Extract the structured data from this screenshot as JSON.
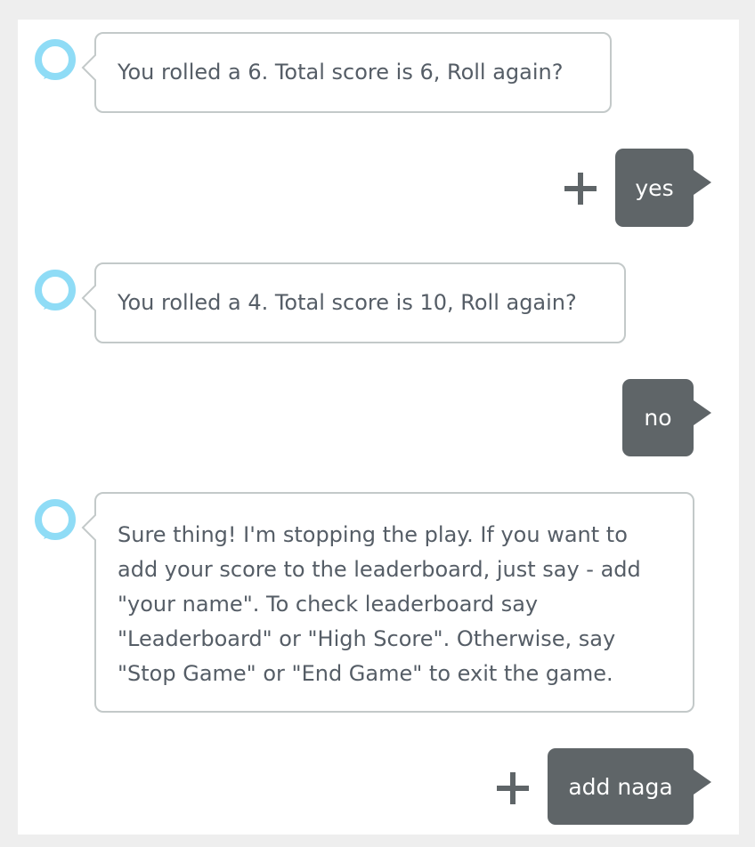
{
  "conversation": {
    "messages": [
      {
        "speaker": "alexa",
        "text": "You rolled a 6. Total score is 6, Roll again?"
      },
      {
        "speaker": "user",
        "text": "yes"
      },
      {
        "speaker": "alexa",
        "text": "You rolled a 4. Total score is 10, Roll again?"
      },
      {
        "speaker": "user",
        "text": "no"
      },
      {
        "speaker": "alexa",
        "lines": [
          "Sure thing! I'm stopping the play. If you want to",
          "add your score to the leaderboard, just say - add",
          "\"your name\". To check leaderboard say",
          "\"Leaderboard\" or \"High Score\". Otherwise, say",
          "\"Stop Game\" or \"End Game\" to exit the game."
        ]
      },
      {
        "speaker": "user",
        "text": "add naga"
      }
    ]
  },
  "colors": {
    "alexa_ring": "#8fdcf6",
    "alexa_border": "#c3c9c9",
    "alexa_text": "#555d66",
    "user_bubble": "#5f6568",
    "plus_icon": "#5f6568"
  }
}
